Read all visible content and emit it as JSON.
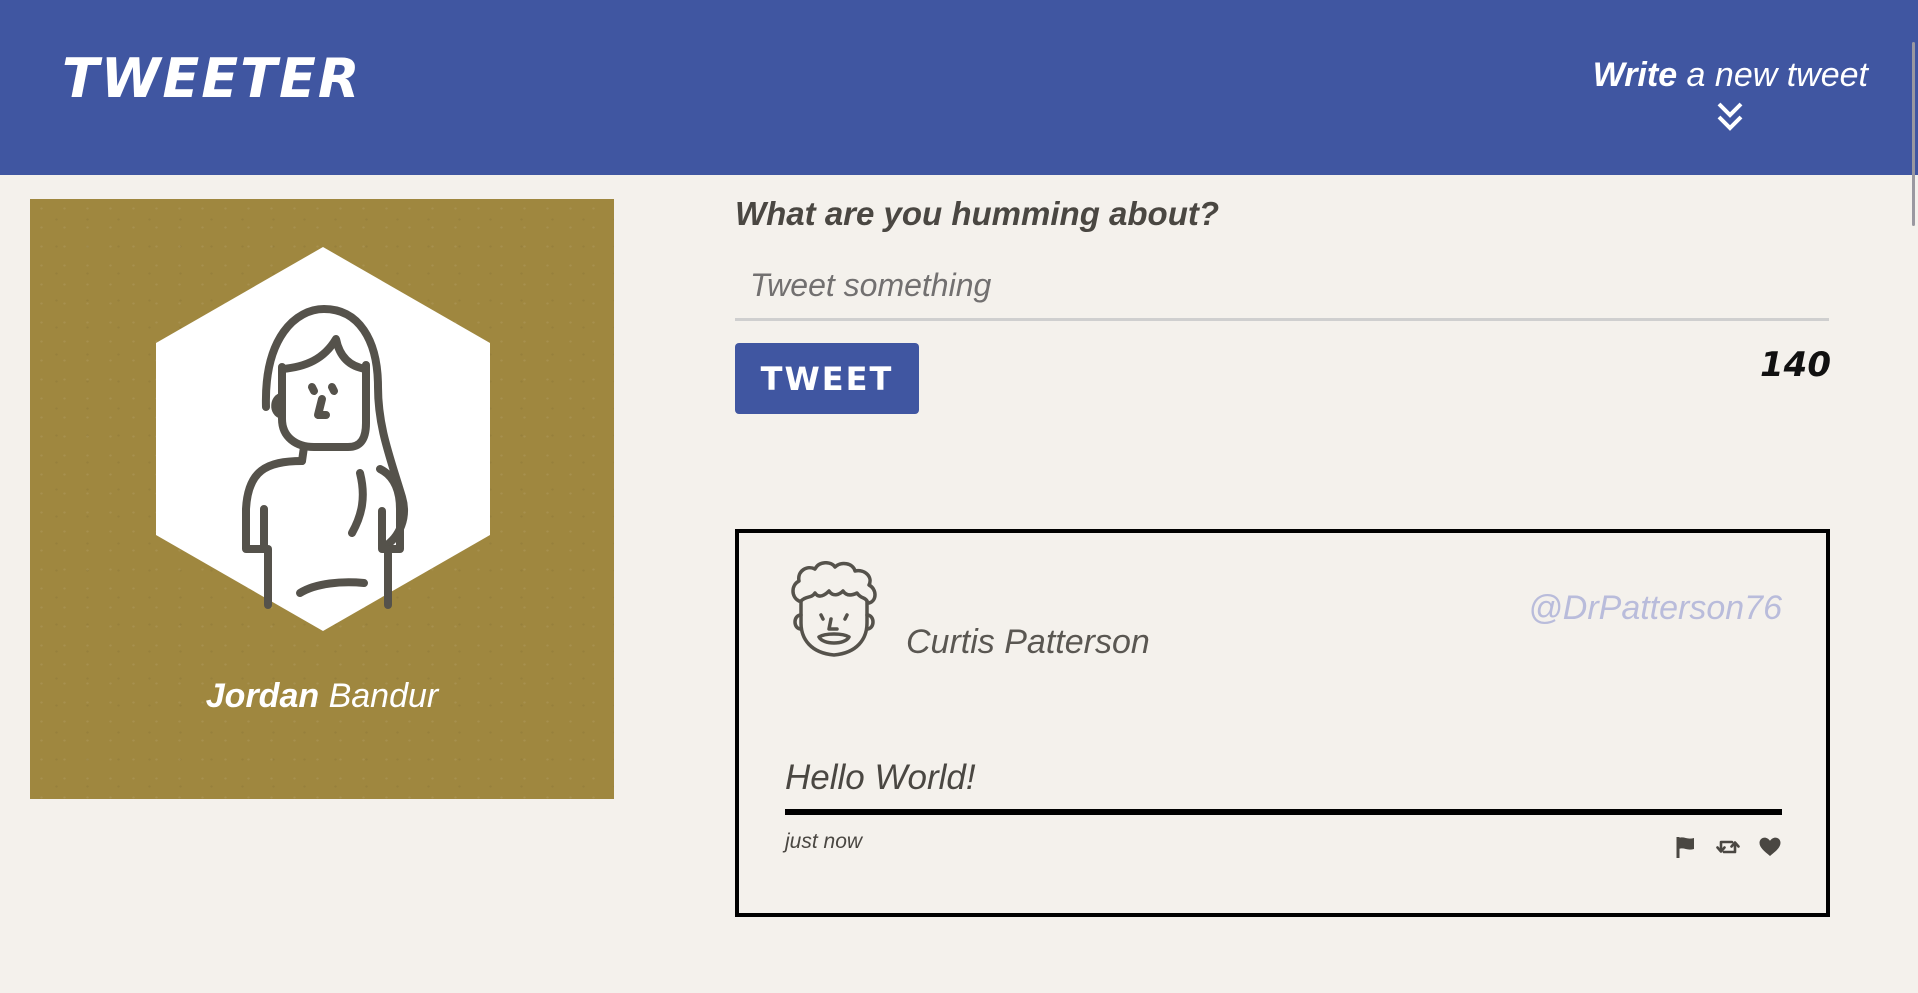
{
  "header": {
    "logo": "TWEETER",
    "compose_bold": "Write",
    "compose_rest": " a new tweet",
    "compose_icon": "double-chevron-down-icon"
  },
  "profile": {
    "first_name": "Jordan",
    "last_name": "Bandur",
    "avatar_icon": "woman-avatar-icon",
    "background_color": "#9f873f"
  },
  "composer": {
    "prompt": "What are you humming about?",
    "input_placeholder": "Tweet something",
    "input_value": "",
    "button_label": "TWEET",
    "counter": "140"
  },
  "tweets": [
    {
      "author": "Curtis Patterson",
      "handle": "@DrPatterson76",
      "avatar_icon": "curly-hair-man-avatar-icon",
      "text": "Hello World!",
      "timestamp": "just now",
      "actions": [
        "flag-icon",
        "retweet-icon",
        "heart-icon"
      ]
    }
  ],
  "colors": {
    "brand": "#4056a1",
    "page_background": "#f4f1ec",
    "handle": "#b9bcdb"
  }
}
